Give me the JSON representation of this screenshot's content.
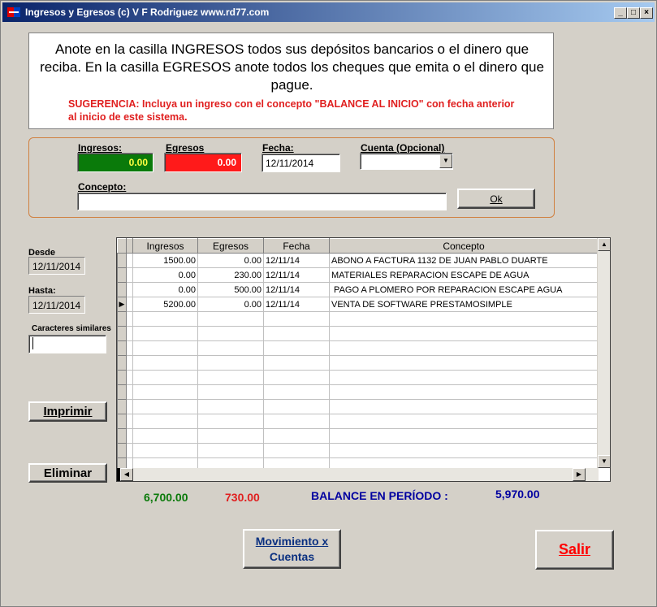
{
  "window": {
    "title": "Ingresos y Egresos (c) V F Rodriguez www.rd77.com",
    "minimize": "_",
    "maximize": "□",
    "close": "×"
  },
  "info": {
    "main": "Anote en la casilla INGRESOS todos sus depósitos bancarios o el dinero que reciba. En la casilla EGRESOS anote todos los cheques que emita o el dinero que pague.",
    "tip": "SUGERENCIA: Incluya un ingreso con el concepto \"BALANCE AL INICIO\" con fecha anterior al inicio de este sistema."
  },
  "entry": {
    "ingresos_label": "Ingresos:",
    "ingresos_value": "0.00",
    "egresos_label": "Egresos",
    "egresos_value": "0.00",
    "fecha_label": "Fecha:",
    "fecha_value": "12/11/2014",
    "cuenta_label": "Cuenta (Opcional)",
    "cuenta_value": "",
    "concepto_label": "Concepto:",
    "concepto_value": "",
    "ok_label": "Ok"
  },
  "filters": {
    "desde_label": "Desde",
    "desde_value": "12/11/2014",
    "hasta_label": "Hasta:",
    "hasta_value": "12/11/2014",
    "similar_label": "Caracteres similares",
    "similar_value": ""
  },
  "buttons": {
    "imprimir": "Imprimir",
    "eliminar": "Eliminar",
    "movimiento_line1": "Movimiento x",
    "movimiento_line2": "Cuentas",
    "salir": "Salir"
  },
  "grid": {
    "columns": [
      "Ingresos",
      "Egresos",
      "Fecha",
      "Concepto"
    ],
    "rows": [
      {
        "ingresos": "1500.00",
        "egresos": "0.00",
        "fecha": "12/11/14",
        "concepto": "ABONO A FACTURA 1132 DE JUAN PABLO DUARTE"
      },
      {
        "ingresos": "0.00",
        "egresos": "230.00",
        "fecha": "12/11/14",
        "concepto": "MATERIALES REPARACION ESCAPE DE AGUA"
      },
      {
        "ingresos": "0.00",
        "egresos": "500.00",
        "fecha": "12/11/14",
        "concepto": " PAGO A PLOMERO POR REPARACION ESCAPE AGUA"
      },
      {
        "ingresos": "5200.00",
        "egresos": "0.00",
        "fecha": "12/11/14",
        "concepto": "VENTA DE SOFTWARE PRESTAMOSIMPLE"
      }
    ],
    "current_row_marker": "▶"
  },
  "totals": {
    "ingresos": "6,700.00",
    "egresos": "730.00",
    "balance_label": "BALANCE EN PERÍODO :",
    "balance_value": "5,970.00"
  },
  "colors": {
    "ingresos_field": "#0a7a0a",
    "egresos_field": "#ff1a1a",
    "ingresos_total": "#0a7a0a",
    "egresos_total": "#e02020",
    "balance": "#0000a0",
    "salir": "#ff0000",
    "movimiento": "#0a3080"
  }
}
